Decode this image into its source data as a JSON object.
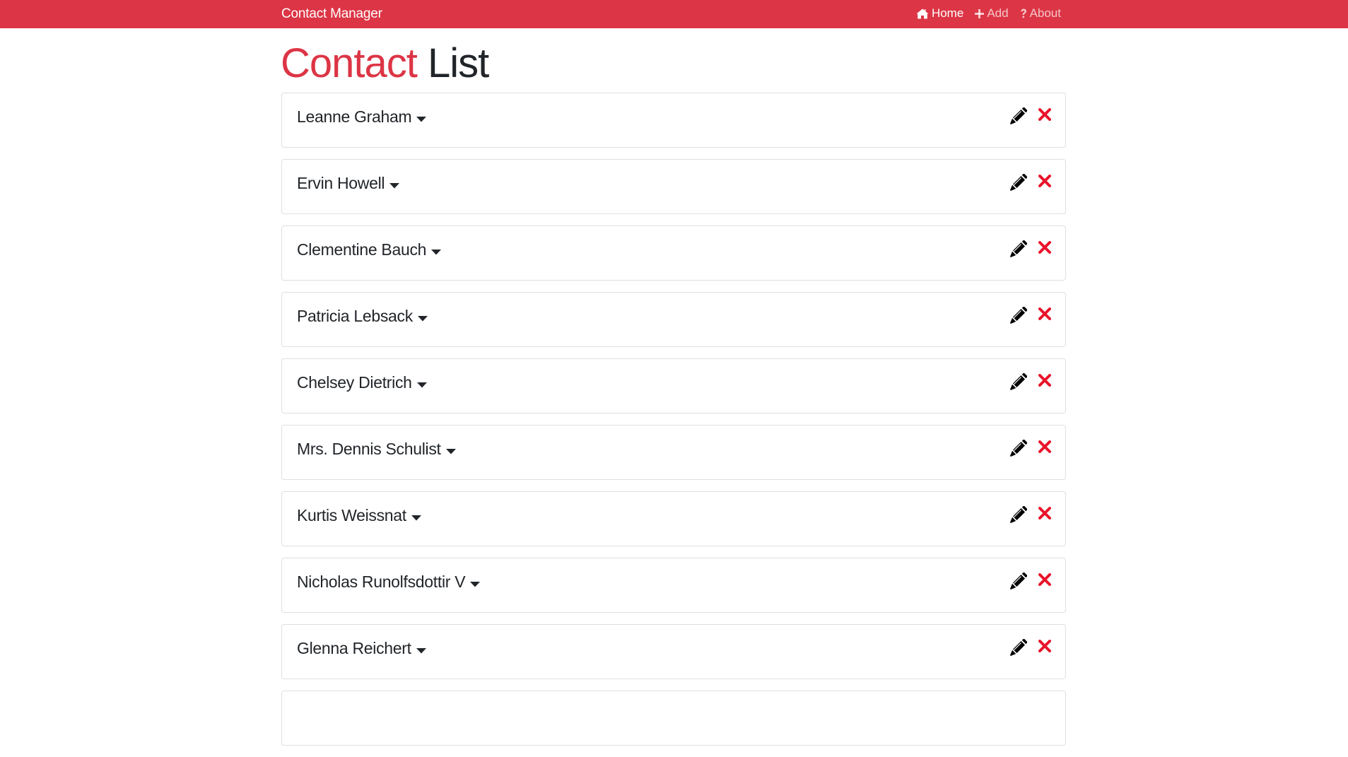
{
  "navbar": {
    "brand": "Contact Manager",
    "links": [
      {
        "label": "Home",
        "icon": "home-icon",
        "active": true
      },
      {
        "label": "Add",
        "icon": "plus-icon",
        "active": false
      },
      {
        "label": "About",
        "icon": "question-icon",
        "active": false
      }
    ]
  },
  "page": {
    "title_accent": "Contact",
    "title_rest": "List"
  },
  "contacts": [
    {
      "name": "Leanne Graham"
    },
    {
      "name": "Ervin Howell"
    },
    {
      "name": "Clementine Bauch"
    },
    {
      "name": "Patricia Lebsack"
    },
    {
      "name": "Chelsey Dietrich"
    },
    {
      "name": "Mrs. Dennis Schulist"
    },
    {
      "name": "Kurtis Weissnat"
    },
    {
      "name": "Nicholas Runolfsdottir V"
    },
    {
      "name": "Glenna Reichert"
    },
    {
      "name": ""
    }
  ],
  "icons": {
    "caret": "caret-down-icon",
    "edit": "pencil-icon",
    "delete": "times-icon"
  },
  "colors": {
    "primary": "#dc3545",
    "delete": "#e8142a",
    "text": "#212529"
  }
}
